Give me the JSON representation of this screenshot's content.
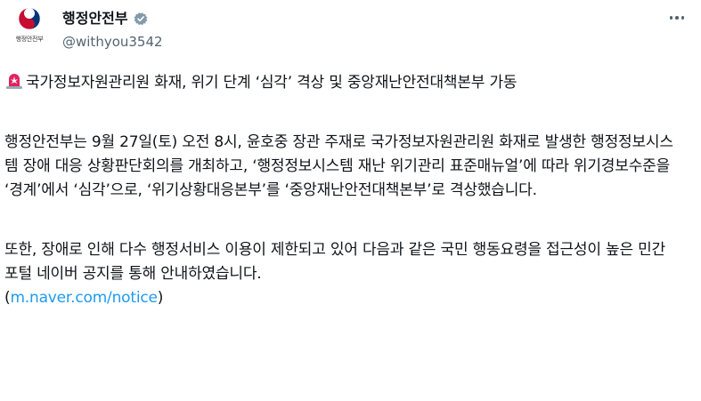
{
  "author": {
    "display_name": "행정안전부",
    "handle": "@withyou3542",
    "avatar_caption": "행정안전부",
    "avatar_icon": "taegeuk-logo-icon",
    "verified_icon": "verified-badge-icon"
  },
  "post": {
    "headline_icon": "siren-icon",
    "headline": "국가정보자원관리원 화재, 위기 단계 ‘심각’ 격상 및 중앙재난안전대책본부 가동",
    "paragraph1": "행정안전부는 9월 27일(토) 오전 8시, 윤호중 장관 주재로 국가정보자원관리원 화재로 발생한 행정정보시스템 장애 대응 상황판단회의를 개최하고, ‘행정정보시스템 재난 위기관리 표준매뉴얼’에 따라 위기경보수준을 ‘경계’에서 ‘심각’으로, ‘위기상황대응본부’를 ‘중앙재난안전대책본부’로 격상했습니다.",
    "paragraph2": "또한, 장애로 인해 다수 행정서비스 이용이 제한되고 있어 다음과 같은 국민 행동요령을 접근성이 높은 민간 포털 네이버 공지를 통해 안내하였습니다.",
    "link_open": "(",
    "link_text": "m.naver.com/notice",
    "link_close": ")"
  },
  "menu": {
    "more_icon": "more-options-icon"
  },
  "colors": {
    "text": "#0f1419",
    "secondary": "#536471",
    "link": "#1d9bf0",
    "verified": "#829aab",
    "siren": "#e0245e"
  }
}
